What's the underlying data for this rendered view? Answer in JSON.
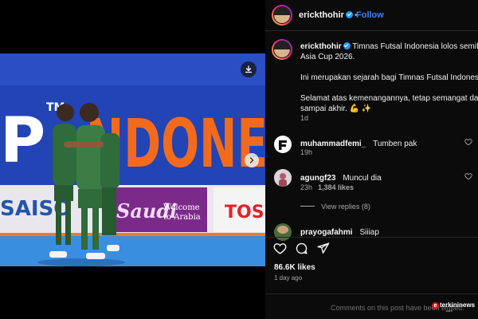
{
  "post": {
    "author": "erickthohir",
    "follow_label": "Follow",
    "separator": "•",
    "caption_lines": [
      "Timnas Futsal Indonesia lolos semifinal",
      "Asia Cup 2026.",
      "Ini merupakan sejarah bagi Timnas Futsal Indonesia.",
      "Selamat atas kemenangannya, tetap semangat dan b",
      "sampai akhir. 💪 ✨"
    ],
    "caption_time": "1d"
  },
  "photo": {
    "banner_left": "P",
    "banner_tm": "TM",
    "banner_main": "NDONE",
    "board_left": "SAISO",
    "board_saudi": "Saudi",
    "board_welcome": "Welcome",
    "board_arabia": "to Arabia",
    "board_right": "TOS"
  },
  "comments": [
    {
      "user": "muhammadfemi_",
      "text": "Tumben pak",
      "time": "19h",
      "likes": ""
    },
    {
      "user": "agungf23",
      "text": "Muncul dia",
      "time": "23h",
      "likes": "1,384 likes"
    },
    {
      "user": "prayogafahmi",
      "text": "Siiiap",
      "time": "",
      "likes": ""
    }
  ],
  "view_replies": "View replies (8)",
  "likes_count": "86.6K likes",
  "posted_ago": "1 day ago",
  "comments_limited": "Comments on this post have been limited.",
  "watermark": {
    "brand": "terkininews",
    "sub": ".com",
    "e": "e"
  },
  "colors": {
    "follow": "#3b82f6",
    "verified": "#1d9bf0",
    "banner_orange": "#f26b1d",
    "banner_blue": "#1f3fa5"
  },
  "icons": [
    "download-icon",
    "chevron-right-icon",
    "verified-icon",
    "heart-icon",
    "comment-icon",
    "share-icon"
  ]
}
